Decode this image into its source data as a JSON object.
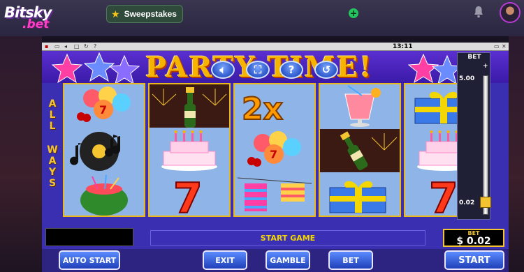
{
  "header": {
    "logo_top": "Bitsky",
    "logo_bottom": ".bet",
    "sweepstakes_label": "Sweepstakes"
  },
  "game": {
    "clock": "13:11",
    "banner_title": "PARTY TIME!",
    "all_ways": [
      "A",
      "L",
      "L",
      "W",
      "A",
      "Y",
      "S"
    ],
    "slider": {
      "label": "BET",
      "max_label": "+",
      "min_label": "-",
      "top_value": "5.00",
      "current_value": "0.02"
    },
    "status_text": "START GAME",
    "bet_box": {
      "label": "BET",
      "value": "$ 0.02"
    },
    "buttons": {
      "auto_start": "AUTO START",
      "exit": "EXIT",
      "gamble": "GAMBLE",
      "bet": "BET",
      "start": "START"
    },
    "reel_symbols": [
      [
        "balloons-seven",
        "music-note",
        "watermelon"
      ],
      [
        "champagne",
        "birthday-cake",
        "seven"
      ],
      [
        "multiplier-2x",
        "balloons-seven",
        "bunting"
      ],
      [
        "cocktail",
        "champagne",
        "gift-box"
      ],
      [
        "gift-box",
        "birthday-cake",
        "seven"
      ]
    ],
    "multiplier_text": "2x",
    "seven_text": "7"
  },
  "colors": {
    "accent": "#f4c431",
    "frame": "#3a2fb0",
    "plus": "#22c55e"
  }
}
